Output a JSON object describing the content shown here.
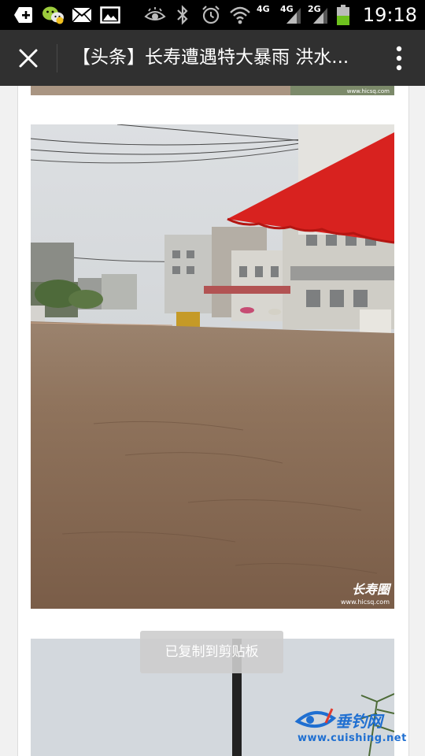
{
  "status_bar": {
    "network_labels": [
      "4G",
      "4G",
      "2G"
    ],
    "time": "19:18",
    "icons": [
      "add-icon",
      "wechat-icon",
      "mail-icon",
      "image-icon",
      "eye-icon",
      "bluetooth-icon",
      "alarm-icon",
      "wifi-icon",
      "signal-icon",
      "battery-icon"
    ],
    "battery_level": 0.5
  },
  "header": {
    "title": "【头条】长寿遭遇特大暴雨 洪水...",
    "close_icon": "close-icon",
    "more_icon": "more-vertical-icon",
    "background": "#303030"
  },
  "content": {
    "photo_watermark_url": "www.hicsq.com",
    "photo_brand": "长寿圈",
    "photo_brand_url": "www.hicsq.com"
  },
  "toast": {
    "text": "已复制到剪贴板"
  },
  "site_watermark": {
    "name": "垂钓网",
    "url": "www.cuishing.net",
    "color": "#1f6fd1"
  }
}
